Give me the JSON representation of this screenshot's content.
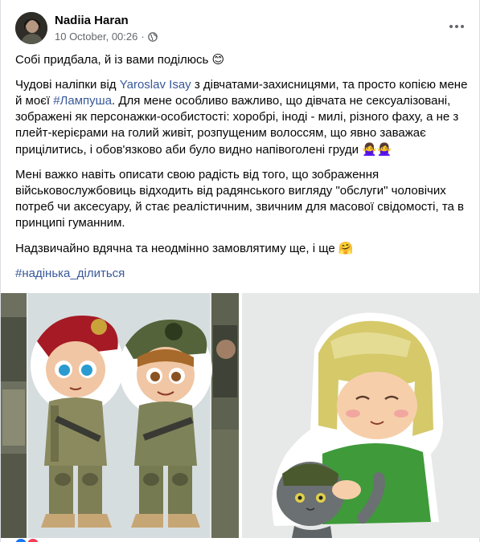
{
  "post": {
    "author": "Nadiia Haran",
    "timestamp": "10 October, 00:26",
    "separator": "·",
    "privacy_icon": "globe-icon",
    "more_icon": "more-dots-icon"
  },
  "body": {
    "p1_text": "Собі придбала, й із вами поділюсь ",
    "p1_emoji": "😊",
    "p2_a": "Чудові наліпки від ",
    "p2_link_person": "Yaroslav Isay",
    "p2_b": " з дівчатами-захисницями, та просто копією мене й моєї ",
    "p2_link_tag": "#Лампуша",
    "p2_c": ". Для мене особливо важливо, що дівчата не сексуалізовані, зображені як персонажки-особистості: хоробрі, іноді - милі, різного фаху, а не з плейт-керієрами на голий живіт, розпущеним волоссям, що явно заважає прицілитись, і обов'язково аби було видно напівоголені груди ",
    "p2_emoji": "🙅‍♀️🙅‍♀️",
    "p3_text": "Мені важко навіть описати свою радість від того, що зображення військовослужбовиць відходить від радянського вигляду \"обслуги\" чоловічих потреб чи аксесуару, й стає реалістичним, звичним для масової свідомості, та в принципі гуманним.",
    "p4_text": "Надзвичайно вдячна та неодмінно замовлятиму ще, і ще ",
    "p4_emoji": "🤗",
    "hashtag": "#надінька_ділиться"
  },
  "colors": {
    "link": "#385898",
    "secondary_text": "#65676b",
    "primary_text": "#050505"
  }
}
